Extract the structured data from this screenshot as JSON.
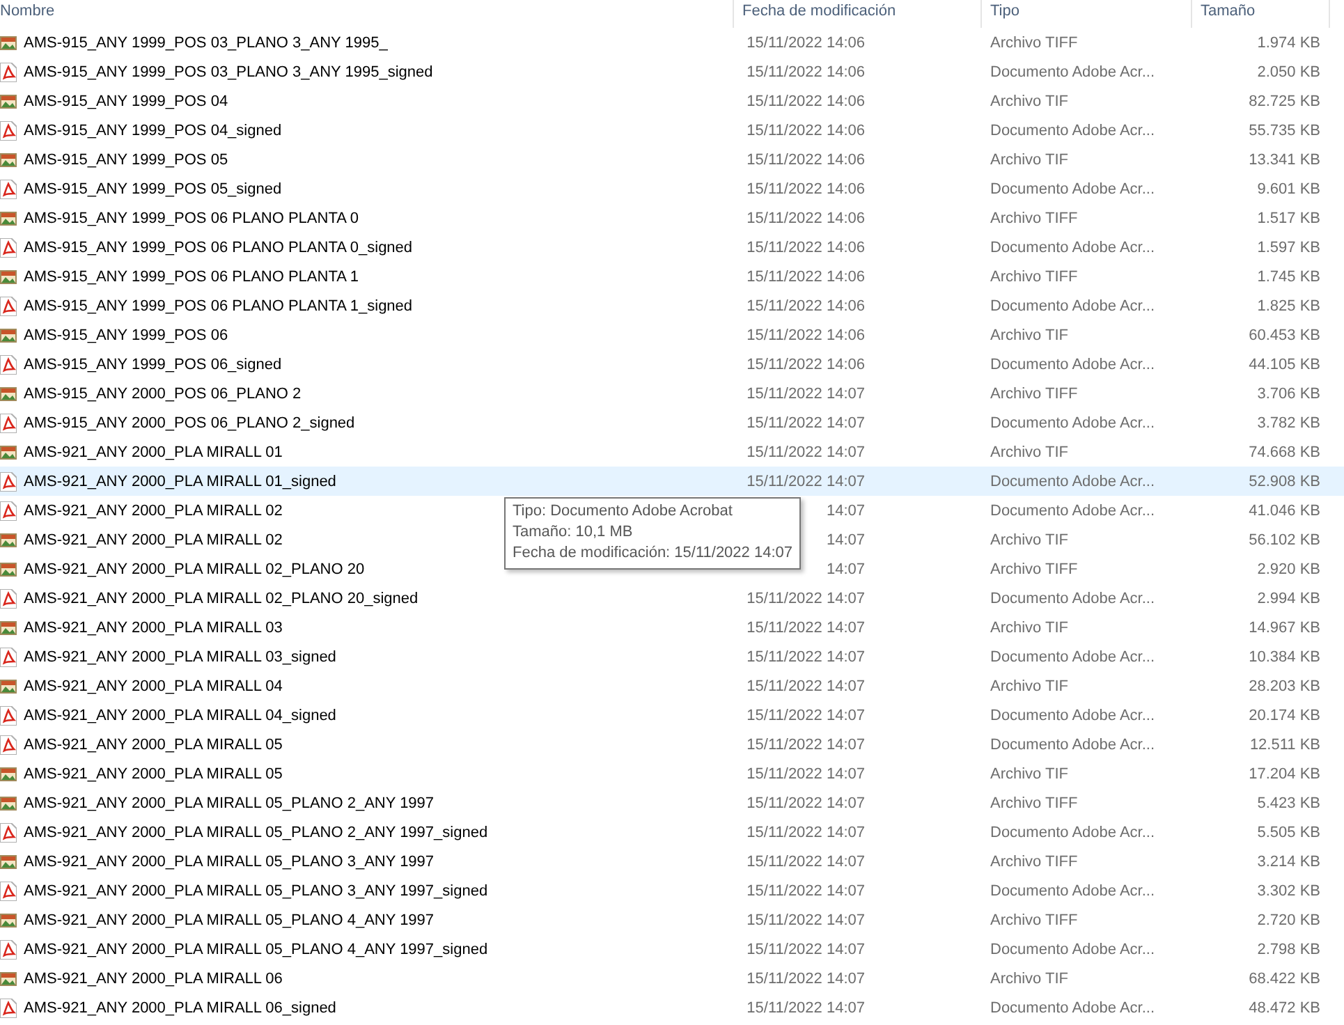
{
  "columns": [
    "Nombre",
    "Fecha de modificación",
    "Tipo",
    "Tamaño"
  ],
  "rows": [
    {
      "kind": "tiff",
      "name": "AMS-915_ANY 1999_POS 03_PLANO 3_ANY 1995_",
      "date": "15/11/2022 14:06",
      "type": "Archivo TIFF",
      "size": "1.974 KB",
      "selected": false
    },
    {
      "kind": "pdf",
      "name": "AMS-915_ANY 1999_POS 03_PLANO 3_ANY 1995_signed",
      "date": "15/11/2022 14:06",
      "type": "Documento Adobe Acr...",
      "size": "2.050 KB",
      "selected": false
    },
    {
      "kind": "tiff",
      "name": "AMS-915_ANY 1999_POS 04",
      "date": "15/11/2022 14:06",
      "type": "Archivo TIF",
      "size": "82.725 KB",
      "selected": false
    },
    {
      "kind": "pdf",
      "name": "AMS-915_ANY 1999_POS 04_signed",
      "date": "15/11/2022 14:06",
      "type": "Documento Adobe Acr...",
      "size": "55.735 KB",
      "selected": false
    },
    {
      "kind": "tiff",
      "name": "AMS-915_ANY 1999_POS 05",
      "date": "15/11/2022 14:06",
      "type": "Archivo TIF",
      "size": "13.341 KB",
      "selected": false
    },
    {
      "kind": "pdf",
      "name": "AMS-915_ANY 1999_POS 05_signed",
      "date": "15/11/2022 14:06",
      "type": "Documento Adobe Acr...",
      "size": "9.601 KB",
      "selected": false
    },
    {
      "kind": "tiff",
      "name": "AMS-915_ANY 1999_POS 06 PLANO PLANTA 0",
      "date": "15/11/2022 14:06",
      "type": "Archivo TIFF",
      "size": "1.517 KB",
      "selected": false
    },
    {
      "kind": "pdf",
      "name": "AMS-915_ANY 1999_POS 06 PLANO PLANTA 0_signed",
      "date": "15/11/2022 14:06",
      "type": "Documento Adobe Acr...",
      "size": "1.597 KB",
      "selected": false
    },
    {
      "kind": "tiff",
      "name": "AMS-915_ANY 1999_POS 06 PLANO PLANTA 1",
      "date": "15/11/2022 14:06",
      "type": "Archivo TIFF",
      "size": "1.745 KB",
      "selected": false
    },
    {
      "kind": "pdf",
      "name": "AMS-915_ANY 1999_POS 06 PLANO PLANTA 1_signed",
      "date": "15/11/2022 14:06",
      "type": "Documento Adobe Acr...",
      "size": "1.825 KB",
      "selected": false
    },
    {
      "kind": "tiff",
      "name": "AMS-915_ANY 1999_POS 06",
      "date": "15/11/2022 14:06",
      "type": "Archivo TIF",
      "size": "60.453 KB",
      "selected": false
    },
    {
      "kind": "pdf",
      "name": "AMS-915_ANY 1999_POS 06_signed",
      "date": "15/11/2022 14:06",
      "type": "Documento Adobe Acr...",
      "size": "44.105 KB",
      "selected": false
    },
    {
      "kind": "tiff",
      "name": "AMS-915_ANY 2000_POS 06_PLANO 2",
      "date": "15/11/2022 14:07",
      "type": "Archivo TIFF",
      "size": "3.706 KB",
      "selected": false
    },
    {
      "kind": "pdf",
      "name": "AMS-915_ANY 2000_POS 06_PLANO 2_signed",
      "date": "15/11/2022 14:07",
      "type": "Documento Adobe Acr...",
      "size": "3.782 KB",
      "selected": false
    },
    {
      "kind": "tiff",
      "name": "AMS-921_ANY 2000_PLA MIRALL 01",
      "date": "15/11/2022 14:07",
      "type": "Archivo TIF",
      "size": "74.668 KB",
      "selected": false
    },
    {
      "kind": "pdf",
      "name": "AMS-921_ANY 2000_PLA MIRALL 01_signed",
      "date": "15/11/2022 14:07",
      "type": "Documento Adobe Acr...",
      "size": "52.908 KB",
      "selected": true
    },
    {
      "kind": "pdf",
      "name": "AMS-921_ANY 2000_PLA MIRALL 02",
      "date": "14:07",
      "type": "Documento Adobe Acr...",
      "size": "41.046 KB",
      "selected": false
    },
    {
      "kind": "tiff",
      "name": "AMS-921_ANY 2000_PLA MIRALL 02",
      "date": "14:07",
      "type": "Archivo TIF",
      "size": "56.102 KB",
      "selected": false
    },
    {
      "kind": "tiff",
      "name": "AMS-921_ANY 2000_PLA MIRALL 02_PLANO 20",
      "date": "14:07",
      "type": "Archivo TIFF",
      "size": "2.920 KB",
      "selected": false
    },
    {
      "kind": "pdf",
      "name": "AMS-921_ANY 2000_PLA MIRALL 02_PLANO 20_signed",
      "date": "15/11/2022 14:07",
      "type": "Documento Adobe Acr...",
      "size": "2.994 KB",
      "selected": false
    },
    {
      "kind": "tiff",
      "name": "AMS-921_ANY 2000_PLA MIRALL 03",
      "date": "15/11/2022 14:07",
      "type": "Archivo TIF",
      "size": "14.967 KB",
      "selected": false
    },
    {
      "kind": "pdf",
      "name": "AMS-921_ANY 2000_PLA MIRALL 03_signed",
      "date": "15/11/2022 14:07",
      "type": "Documento Adobe Acr...",
      "size": "10.384 KB",
      "selected": false
    },
    {
      "kind": "tiff",
      "name": "AMS-921_ANY 2000_PLA MIRALL 04",
      "date": "15/11/2022 14:07",
      "type": "Archivo TIF",
      "size": "28.203 KB",
      "selected": false
    },
    {
      "kind": "pdf",
      "name": "AMS-921_ANY 2000_PLA MIRALL 04_signed",
      "date": "15/11/2022 14:07",
      "type": "Documento Adobe Acr...",
      "size": "20.174 KB",
      "selected": false
    },
    {
      "kind": "pdf",
      "name": "AMS-921_ANY 2000_PLA MIRALL 05",
      "date": "15/11/2022 14:07",
      "type": "Documento Adobe Acr...",
      "size": "12.511 KB",
      "selected": false
    },
    {
      "kind": "tiff",
      "name": "AMS-921_ANY 2000_PLA MIRALL 05",
      "date": "15/11/2022 14:07",
      "type": "Archivo TIF",
      "size": "17.204 KB",
      "selected": false
    },
    {
      "kind": "tiff",
      "name": "AMS-921_ANY 2000_PLA MIRALL 05_PLANO 2_ANY 1997",
      "date": "15/11/2022 14:07",
      "type": "Archivo TIFF",
      "size": "5.423 KB",
      "selected": false
    },
    {
      "kind": "pdf",
      "name": "AMS-921_ANY 2000_PLA MIRALL 05_PLANO 2_ANY 1997_signed",
      "date": "15/11/2022 14:07",
      "type": "Documento Adobe Acr...",
      "size": "5.505 KB",
      "selected": false
    },
    {
      "kind": "tiff",
      "name": "AMS-921_ANY 2000_PLA MIRALL 05_PLANO 3_ANY 1997",
      "date": "15/11/2022 14:07",
      "type": "Archivo TIFF",
      "size": "3.214 KB",
      "selected": false
    },
    {
      "kind": "pdf",
      "name": "AMS-921_ANY 2000_PLA MIRALL 05_PLANO 3_ANY 1997_signed",
      "date": "15/11/2022 14:07",
      "type": "Documento Adobe Acr...",
      "size": "3.302 KB",
      "selected": false
    },
    {
      "kind": "tiff",
      "name": "AMS-921_ANY 2000_PLA MIRALL 05_PLANO 4_ANY 1997",
      "date": "15/11/2022 14:07",
      "type": "Archivo TIFF",
      "size": "2.720 KB",
      "selected": false
    },
    {
      "kind": "pdf",
      "name": "AMS-921_ANY 2000_PLA MIRALL 05_PLANO 4_ANY 1997_signed",
      "date": "15/11/2022 14:07",
      "type": "Documento Adobe Acr...",
      "size": "2.798 KB",
      "selected": false
    },
    {
      "kind": "tiff",
      "name": "AMS-921_ANY 2000_PLA MIRALL 06",
      "date": "15/11/2022 14:07",
      "type": "Archivo TIF",
      "size": "68.422 KB",
      "selected": false
    },
    {
      "kind": "pdf",
      "name": "AMS-921_ANY 2000_PLA MIRALL 06_signed",
      "date": "15/11/2022 14:07",
      "type": "Documento Adobe Acr...",
      "size": "48.472 KB",
      "selected": false
    }
  ],
  "tooltip": [
    "Tipo: Documento Adobe Acrobat",
    "Tamaño: 10,1 MB",
    "Fecha de modificación: 15/11/2022 14:07"
  ]
}
